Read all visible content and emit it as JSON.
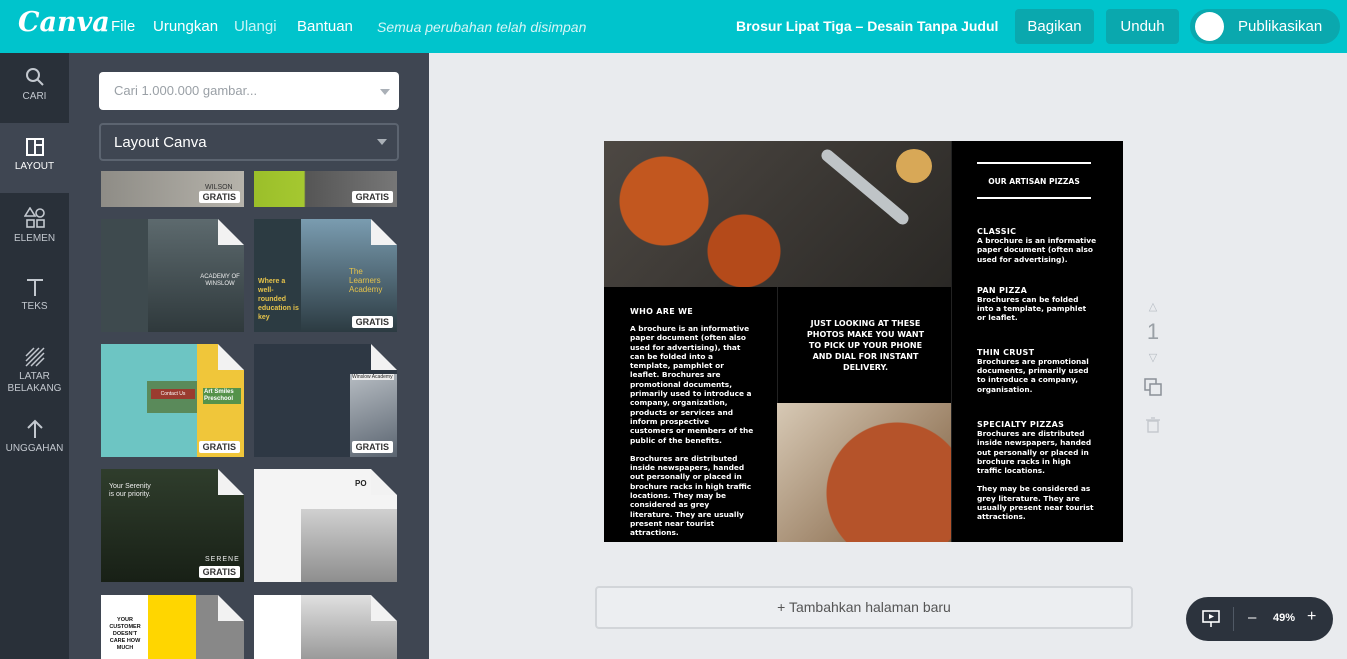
{
  "app": {
    "logo": "Canva"
  },
  "header": {
    "menu": [
      "File",
      "Urungkan",
      "Ulangi",
      "Bantuan"
    ],
    "saved_status": "Semua perubahan telah disimpan",
    "doc_title": "Brosur Lipat Tiga – Desain Tanpa Judul",
    "share_label": "Bagikan",
    "download_label": "Unduh",
    "publish_label": "Publikasikan"
  },
  "sidebar": {
    "items": [
      {
        "label": "CARI",
        "icon": "search-icon"
      },
      {
        "label": "LAYOUT",
        "icon": "layout-icon"
      },
      {
        "label": "ELEMEN",
        "icon": "shapes-icon"
      },
      {
        "label": "TEKS",
        "icon": "text-icon"
      },
      {
        "label": "LATAR BELAKANG",
        "icon": "pattern-icon"
      },
      {
        "label": "UNGGAHAN",
        "icon": "upload-arrow-icon"
      }
    ]
  },
  "panel": {
    "search_placeholder": "Cari 1.000.000 gambar...",
    "layout_select": "Layout Canva",
    "badge": "GRATIS",
    "templates": [
      {
        "text": "WILSON",
        "badge": "GRATIS"
      },
      {
        "text": "",
        "badge": "GRATIS"
      },
      {
        "text": "ACADEMY OF WINSLOW",
        "badge": ""
      },
      {
        "text": "The Learners Academy",
        "sub": "Where a well-rounded education is key",
        "badge": "GRATIS"
      },
      {
        "text": "Art Smiles Preschool",
        "sub": "Contact Us",
        "badge": "GRATIS"
      },
      {
        "text": "Winslow Academy",
        "badge": "GRATIS"
      },
      {
        "text": "Your Serenity is our priority.",
        "sub": "SERENE",
        "badge": "GRATIS"
      },
      {
        "text": "PO",
        "badge": ""
      },
      {
        "text": "YOUR CUSTOMER DOESN'T CARE HOW MUCH",
        "badge": ""
      },
      {
        "text": "",
        "badge": ""
      }
    ]
  },
  "brochure": {
    "who_title": "WHO ARE WE",
    "who_p1": "A brochure is an informative paper document (often also used for advertising), that can be folded into a template, pamphlet or leaflet. Brochures are promotional documents, primarily used to introduce a company, organization, products or services and inform prospective customers or members of the public of the benefits.",
    "who_p2": "Brochures are distributed inside newspapers, handed out personally or placed in brochure racks in high traffic locations. They may be considered as grey literature. They are usually present near tourist attractions.",
    "middle_text": "JUST LOOKING AT THESE PHOTOS MAKE YOU WANT TO PICK UP YOUR PHONE AND DIAL FOR INSTANT DELIVERY.",
    "right_title": "OUR ARTISAN PIZZAS",
    "pizzas": [
      {
        "name": "CLASSIC",
        "desc": "A brochure is an informative paper document (often also used for advertising)."
      },
      {
        "name": "PAN PIZZA",
        "desc": "Brochures can be folded into a template, pamphlet or leaflet."
      },
      {
        "name": "THIN CRUST",
        "desc": "Brochures are promotional documents, primarily used to introduce a company, organisation."
      },
      {
        "name": "SPECIALTY PIZZAS",
        "desc": "Brochures are distributed inside newspapers, handed out personally or placed in brochure racks in high traffic locations."
      }
    ],
    "right_p_last": "They may be considered as grey literature. They are usually present near tourist attractions."
  },
  "canvas": {
    "page_number": "1",
    "add_page_label": "+ Tambahkan halaman baru",
    "zoom_minus": "–",
    "zoom_value": "49%",
    "zoom_plus": "+"
  },
  "colors": {
    "brand": "#00c4cc",
    "button": "#0aa8ae",
    "nav": "#293039",
    "panel": "#3f4652"
  }
}
